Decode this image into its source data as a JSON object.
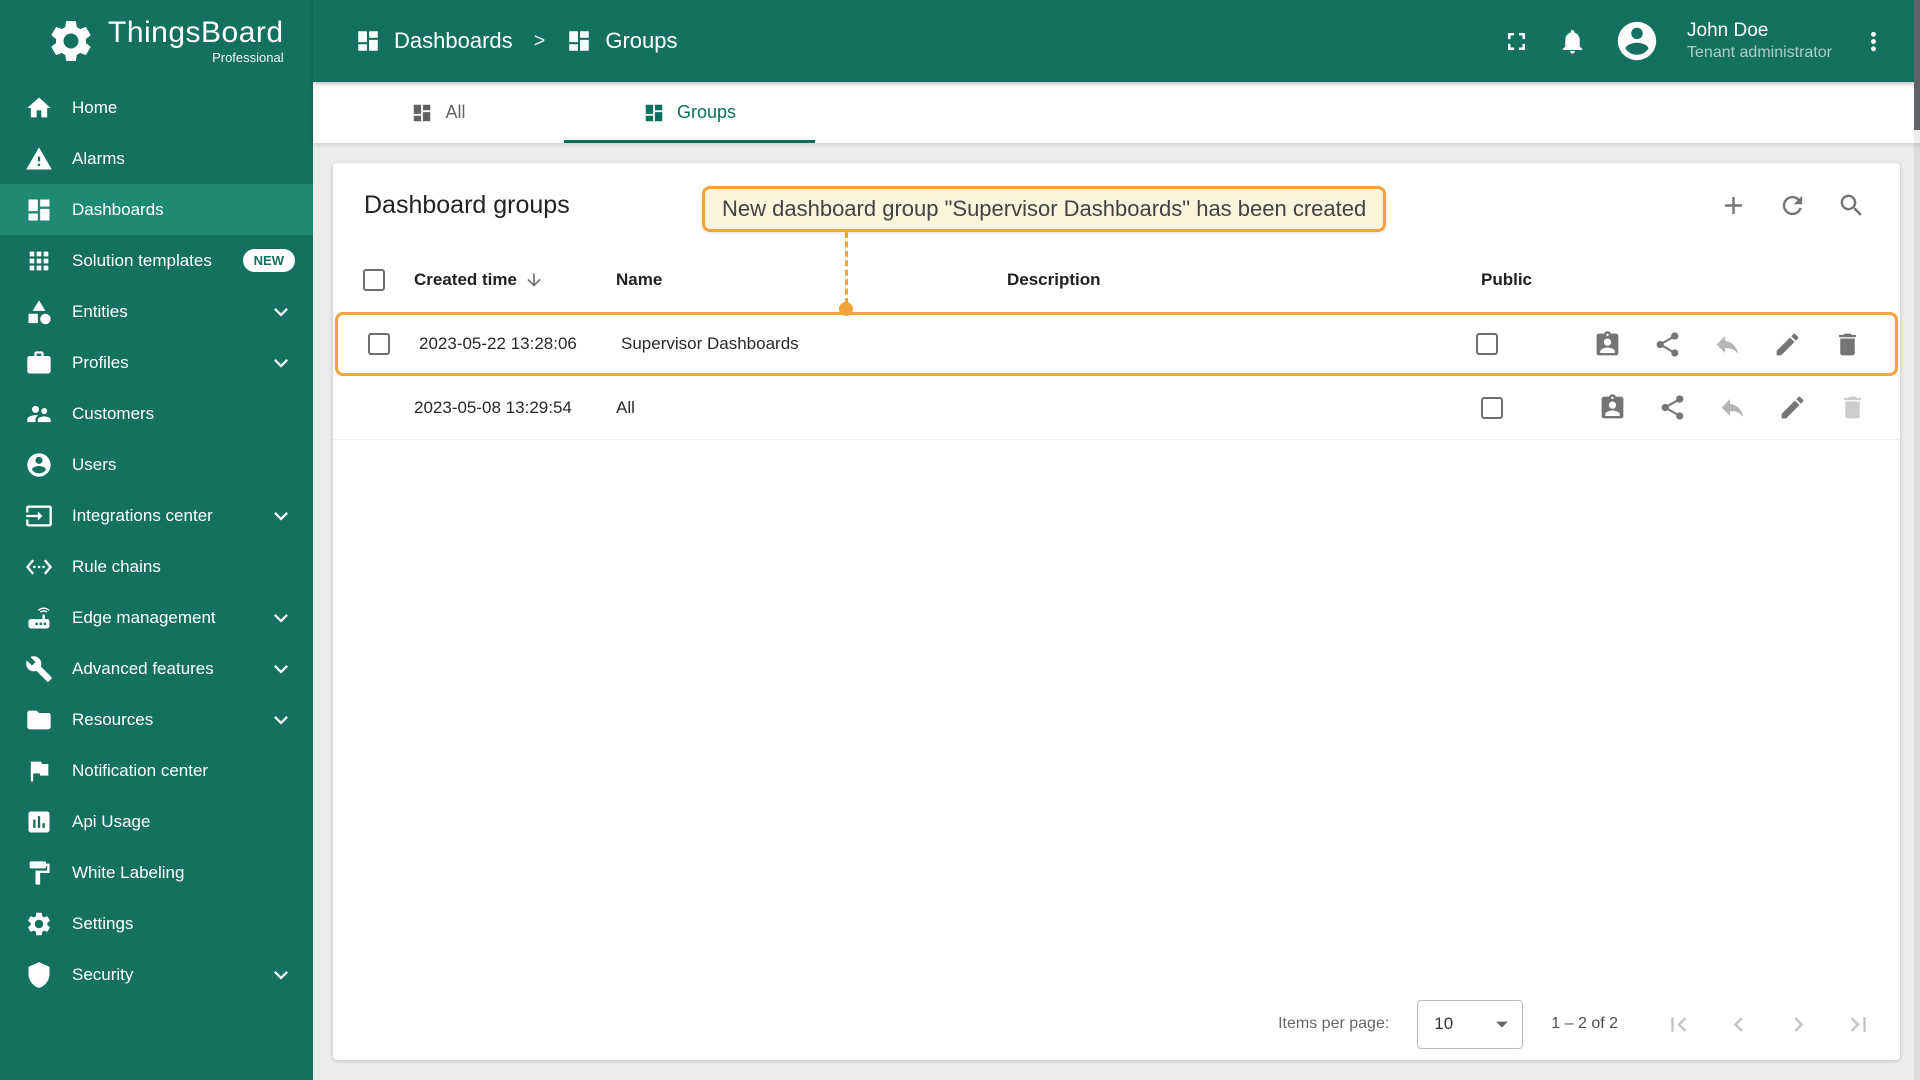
{
  "brand": {
    "name": "ThingsBoard",
    "subtitle": "Professional"
  },
  "topbar": {
    "breadcrumb": [
      {
        "label": "Dashboards"
      },
      {
        "label": "Groups"
      }
    ],
    "separator": ">",
    "user": {
      "name": "John Doe",
      "role": "Tenant administrator"
    }
  },
  "sidebar": [
    {
      "label": "Home"
    },
    {
      "label": "Alarms"
    },
    {
      "label": "Dashboards",
      "active": true
    },
    {
      "label": "Solution templates",
      "badge": "NEW"
    },
    {
      "label": "Entities",
      "expandable": true
    },
    {
      "label": "Profiles",
      "expandable": true
    },
    {
      "label": "Customers"
    },
    {
      "label": "Users"
    },
    {
      "label": "Integrations center",
      "expandable": true
    },
    {
      "label": "Rule chains"
    },
    {
      "label": "Edge management",
      "expandable": true
    },
    {
      "label": "Advanced features",
      "expandable": true
    },
    {
      "label": "Resources",
      "expandable": true
    },
    {
      "label": "Notification center"
    },
    {
      "label": "Api Usage"
    },
    {
      "label": "White Labeling"
    },
    {
      "label": "Settings"
    },
    {
      "label": "Security",
      "expandable": true
    }
  ],
  "tabs": [
    {
      "label": "All",
      "active": false
    },
    {
      "label": "Groups",
      "active": true
    }
  ],
  "content": {
    "title": "Dashboard groups",
    "toast": "New dashboard group \"Supervisor Dashboards\" has been created"
  },
  "table": {
    "headers": {
      "created_time": "Created time",
      "name": "Name",
      "description": "Description",
      "public": "Public"
    },
    "rows": [
      {
        "created_time": "2023-05-22 13:28:06",
        "name": "Supervisor Dashboards",
        "description": ""
      },
      {
        "created_time": "2023-05-08 13:29:54",
        "name": "All",
        "description": ""
      }
    ]
  },
  "paginator": {
    "items_per_page_label": "Items per page:",
    "page_size": "10",
    "range": "1 – 2 of 2"
  },
  "colors": {
    "primary": "#14705F",
    "primary_active": "#1F8A74",
    "accent_orange": "#F2A33A",
    "callout_bg": "#FCF5DC"
  }
}
